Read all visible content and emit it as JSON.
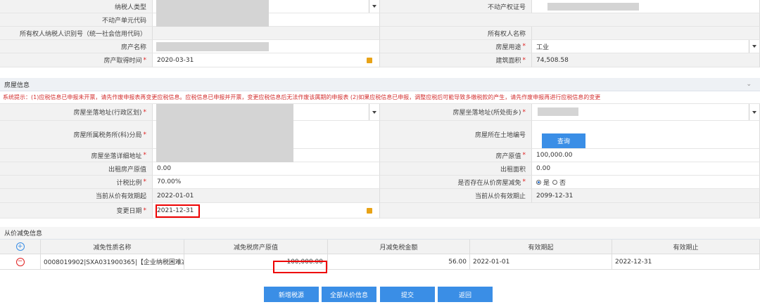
{
  "top": {
    "taxpayer_type_label": "纳税人类型",
    "property_cert_label": "不动产权证号",
    "property_unit_code_label": "不动产单元代码",
    "owner_id_label": "所有权人纳税人识别号（统一社会信用代码）",
    "owner_name_label": "所有权人名称",
    "property_name_label": "房产名称",
    "usage_label": "房屋用途",
    "usage_value": "工业",
    "acquire_time_label": "房产取得时间",
    "acquire_time_value": "2020-03-31",
    "area_label": "建筑面积",
    "area_value": "74,508.58"
  },
  "house_section": {
    "title": "房屋信息",
    "notice": "系统提示：(1)应税信息已申报未开票，请先作废申报表再变更应税信息。应税信息已申报并开票，变更应税信息后无法作废该属期的申报表 (2)如果应税信息已申报，调整应税后可能导致多缴税款的产生，请先作废申报再进行应税信息的变更",
    "location_admin_label": "房屋坐落地址(行政区划)",
    "location_street_label": "房屋坐落地址(所处街乡)",
    "tax_office_label": "房屋所属税务所(科)分局",
    "land_no_label": "房屋所在土地编号",
    "query_button": "查询",
    "detail_address_label": "房屋坐落详细地址",
    "original_value_label": "房产原值",
    "original_value": "100,000.00",
    "rent_original_label": "出租房产原值",
    "rent_original_value": "0.00",
    "rent_area_label": "出租面积",
    "rent_area_value": "0.00",
    "tax_ratio_label": "计税比例",
    "tax_ratio_value": "70.00%",
    "reduction_exists_label": "是否存在从价房屋减免",
    "yes_label": "是",
    "no_label": "否",
    "valid_start_label": "当前从价有效期起",
    "valid_start_value": "2022-01-01",
    "valid_end_label": "当前从价有效期止",
    "valid_end_value": "2099-12-31",
    "change_date_label": "变更日期",
    "change_date_value": "2021-12-31"
  },
  "reduction": {
    "title": "从价减免信息",
    "headers": [
      "减免性质名称",
      "减免税房产原值",
      "月减免税金额",
      "有效期起",
      "有效期止"
    ],
    "rows": [
      {
        "name": "0008019902|SXA031900365|【企业纳税困难减...",
        "original": "100,000.00",
        "monthly": "56.00",
        "start": "2022-01-01",
        "end": "2022-12-31"
      }
    ]
  },
  "buttons": {
    "add": "新增税源",
    "all_price": "全部从价信息",
    "submit": "提交",
    "back": "返回"
  },
  "colors": {
    "accent": "#3a8ee6",
    "highlight": "#e00000",
    "notice": "#d32f2f"
  }
}
